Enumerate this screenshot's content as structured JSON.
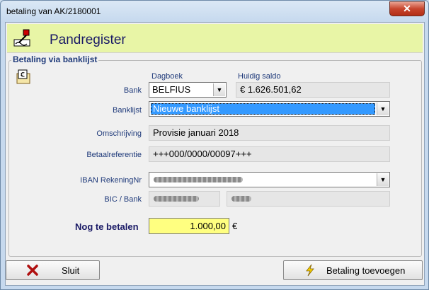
{
  "window": {
    "title": "betaling van AK/2180001",
    "close_label": "✕"
  },
  "header": {
    "title": "Pandregister",
    "icon": "pen-writing-icon"
  },
  "group": {
    "title": "Betaling via banklijst",
    "icon": "euro-wallet-icon"
  },
  "columns": {
    "dagboek": "Dagboek",
    "saldo": "Huidig saldo"
  },
  "fields": {
    "bank": {
      "label": "Bank",
      "value": "BELFIUS",
      "saldo": "€ 1.626.501,62"
    },
    "banklijst": {
      "label": "Banklijst",
      "value": "Nieuwe banklijst"
    },
    "omschrijving": {
      "label": "Omschrijving",
      "value": "Provisie januari 2018"
    },
    "betaalreferentie": {
      "label": "Betaalreferentie",
      "value": "+++000/0000/00097+++"
    },
    "iban": {
      "label": "IBAN RekeningNr"
    },
    "bic": {
      "label": "BIC / Bank"
    }
  },
  "payment": {
    "label": "Nog te betalen",
    "amount": "1.000,00",
    "currency": "€"
  },
  "buttons": {
    "sluit": {
      "label": "Sluit",
      "icon": "red-x-icon"
    },
    "toevoegen": {
      "label": "Betaling toevoegen",
      "icon": "lightning-icon"
    }
  },
  "colors": {
    "header_bg": "#e8f5a6",
    "amount_bg": "#ffff80",
    "selection": "#3399ff",
    "label": "#1f3a7a"
  }
}
